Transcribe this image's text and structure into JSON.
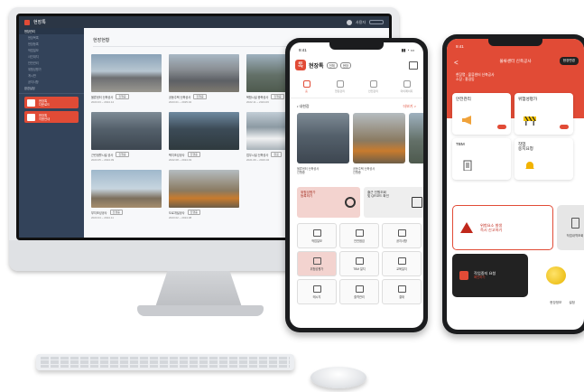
{
  "desktop": {
    "app_title": "현장톡",
    "user_name": "사용자",
    "sidebar": [
      {
        "label": "현장관리",
        "active": true
      },
      {
        "label": "현장목록",
        "sub": true
      },
      {
        "label": "현장등록",
        "sub": true
      },
      {
        "label": "작업일보",
        "sub": true
      },
      {
        "label": "사진대지",
        "sub": true
      },
      {
        "label": "안전관리",
        "sub": true
      },
      {
        "label": "위험성평가",
        "sub": true
      },
      {
        "label": "게시판",
        "sub": true
      },
      {
        "label": "공지사항",
        "sub": true
      },
      {
        "label": "환경설정",
        "sub": false
      }
    ],
    "promo_cards": [
      {
        "line1": "현장톡",
        "line2": "다운로드"
      },
      {
        "line1": "현장톡",
        "line2": "이용안내"
      }
    ],
    "page_title": "현장현황",
    "sites": [
      {
        "name": "물류센터 신축공사",
        "tag": "진행중",
        "sub": "2023.03 ~ 2024.12"
      },
      {
        "name": "공동주택 신축공사",
        "tag": "진행중",
        "sub": "2023.01 ~ 2025.02"
      },
      {
        "name": "복합시설 증축공사",
        "tag": "진행중",
        "sub": "2022.11 ~ 2024.06"
      },
      {
        "name": "근린생활시설 공사",
        "tag": "진행중",
        "sub": "2023.05 ~ 2024.09"
      },
      {
        "name": "택지조성공사",
        "tag": "진행중",
        "sub": "2022.08 ~ 2024.03"
      },
      {
        "name": "업무시설 신축공사",
        "tag": "완료",
        "sub": "2021.06 ~ 2023.02"
      },
      {
        "name": "부지조성공사",
        "tag": "진행중",
        "sub": "2023.04 ~ 2024.11"
      },
      {
        "name": "도로개설공사",
        "tag": "진행중",
        "sub": "2023.02 ~ 2024.08"
      }
    ]
  },
  "phone1": {
    "time": "9:41",
    "logo_char": "톡",
    "site_name": "현장톡",
    "pill1": "전체",
    "pill2": "현장",
    "tabs": [
      {
        "label": "홈",
        "active": true
      },
      {
        "label": "현장관리",
        "active": false
      },
      {
        "label": "안전관리",
        "active": false
      },
      {
        "label": "마이페이지",
        "active": false
      }
    ],
    "section_title": "• 내현장",
    "section_more": "더보기 >",
    "photo_captions": [
      "물류센터 신축공사\n진행중",
      "공동주택 신축공사\n진행중"
    ],
    "banner_red": "위험성평가\n등록하기",
    "banner_gray": "출근 인원조회\n및 QR코드 확인",
    "menu": [
      {
        "label": "작업일보",
        "hl": false
      },
      {
        "label": "안전점검",
        "hl": false
      },
      {
        "label": "공지사항",
        "hl": false
      },
      {
        "label": "위험성평가",
        "hl": true
      },
      {
        "label": "TBM 일지",
        "hl": false
      },
      {
        "label": "교육일지",
        "hl": false
      },
      {
        "label": "메시지",
        "hl": false
      },
      {
        "label": "출역관리",
        "hl": false
      },
      {
        "label": "결재",
        "hl": false
      }
    ]
  },
  "phone2": {
    "time": "9:41",
    "back": "<",
    "title": "물류센터 신축공사",
    "header_btn": "현장변경",
    "info": "현장명 : 물류센터 신축공사\n소장 : 홍길동",
    "cards": [
      {
        "title": "안전관리"
      },
      {
        "title": "위험성평가"
      },
      {
        "title": "TBM"
      },
      {
        "title": "작업\n중지요청"
      }
    ],
    "alert_text": "위험요소 발생\n즉시 신고하기",
    "side1_label": "작업내역조회",
    "dark_title": "작업중지 요청",
    "dark_sub": "확인하기",
    "foot_left": "현장정보",
    "foot_right": "설정"
  }
}
